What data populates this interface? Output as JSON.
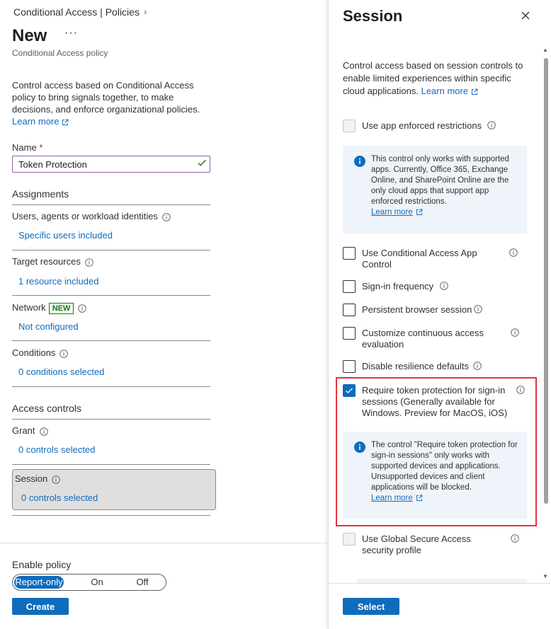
{
  "colors": {
    "accent": "#0f6cbd",
    "highlight": "#e0343c",
    "new_badge": "#107c10",
    "info_bg": "#eff4fa"
  },
  "breadcrumb": {
    "label": "Conditional Access | Policies",
    "chevron": "›"
  },
  "page": {
    "title": "New",
    "more": "···",
    "subtitle": "Conditional Access policy"
  },
  "intro": {
    "text": "Control access based on Conditional Access policy to bring signals together, to make decisions, and enforce organizational policies.",
    "learn_more": "Learn more"
  },
  "name_field": {
    "label": "Name",
    "required": "*",
    "value": "Token Protection"
  },
  "assignments": {
    "heading": "Assignments",
    "users": {
      "label": "Users, agents or workload identities",
      "value": "Specific users included"
    },
    "targets": {
      "label": "Target resources",
      "value": "1 resource included"
    },
    "network": {
      "label": "Network",
      "badge": "NEW",
      "value": "Not configured"
    },
    "conditions": {
      "label": "Conditions",
      "value": "0 conditions selected"
    }
  },
  "access_controls": {
    "heading": "Access controls",
    "grant": {
      "label": "Grant",
      "value": "0 controls selected"
    },
    "session": {
      "label": "Session",
      "value": "0 controls selected"
    }
  },
  "enable_policy": {
    "label": "Enable policy",
    "options": [
      "Report-only",
      "On",
      "Off"
    ],
    "selected": "Report-only"
  },
  "create_button": "Create",
  "session_panel": {
    "title": "Session",
    "description": "Control access based on session controls to enable limited experiences within specific cloud applications.",
    "learn_more": "Learn more",
    "app_enforced": {
      "label": "Use app enforced restrictions",
      "checked": false,
      "disabled": true
    },
    "app_enforced_info": {
      "text": "This control only works with supported apps. Currently, Office 365, Exchange Online, and SharePoint Online are the only cloud apps that support app enforced restrictions.",
      "learn_more": "Learn more"
    },
    "app_control": {
      "label": "Use Conditional Access App Control",
      "checked": false
    },
    "signin_freq": {
      "label": "Sign-in frequency",
      "checked": false
    },
    "persistent": {
      "label": "Persistent browser session",
      "checked": false
    },
    "cae": {
      "label": "Customize continuous access evaluation",
      "checked": false
    },
    "resilience": {
      "label": "Disable resilience defaults",
      "checked": false
    },
    "token_protection": {
      "label": "Require token protection for sign-in sessions (Generally available for Windows. Preview for MacOS, iOS)",
      "checked": true
    },
    "token_info": {
      "text": "The control \"Require token protection for sign-in sessions\" only works with supported devices and applications. Unsupported devices and client applications will be blocked.",
      "learn_more": "Learn more"
    },
    "global_secure": {
      "label": "Use Global Secure Access security profile",
      "checked": false,
      "disabled": true
    },
    "select_button": "Select"
  }
}
